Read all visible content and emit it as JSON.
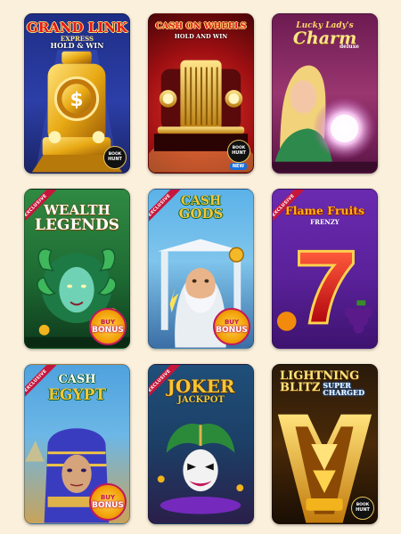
{
  "games": [
    {
      "title_line1": "GRAND LINK",
      "title_line2": "EXPRESS",
      "title_line3": "HOLD & WIN",
      "logo_line1": "BOOK",
      "logo_line2": "HUNT"
    },
    {
      "title_line1": "CASH ON WHEELS",
      "title_line2": "HOLD AND WIN",
      "logo_line1": "BOOK",
      "logo_line2": "HUNT",
      "tag": "NEW"
    },
    {
      "title_line1": "Lucky Lady's",
      "title_line2": "Charm",
      "title_line3": "deluxe"
    },
    {
      "exclusive": "EXCLUSIVE",
      "title_line1": "WEALTH",
      "title_line2": "LEGENDS",
      "bonus_line1": "BUY",
      "bonus_line2": "BONUS"
    },
    {
      "exclusive": "EXCLUSIVE",
      "title_line1": "CASH",
      "title_line2": "GODS",
      "bonus_line1": "BUY",
      "bonus_line2": "BONUS"
    },
    {
      "exclusive": "EXCLUSIVE",
      "title_line1": "Flame Fruits",
      "title_line2": "FRENZY"
    },
    {
      "exclusive": "EXCLUSIVE",
      "title_line1": "CASH",
      "title_line2": "EGYPT",
      "bonus_line1": "BUY",
      "bonus_line2": "BONUS"
    },
    {
      "exclusive": "EXCLUSIVE",
      "title_line1": "JOKER",
      "title_line2": "JACKPOT"
    },
    {
      "title_line1": "LIGHTNING",
      "title_line2": "BLITZ",
      "title_line3": "SUPER",
      "title_line4": "CHARGED",
      "logo_line1": "BOOK",
      "logo_line2": "HUNT"
    }
  ]
}
